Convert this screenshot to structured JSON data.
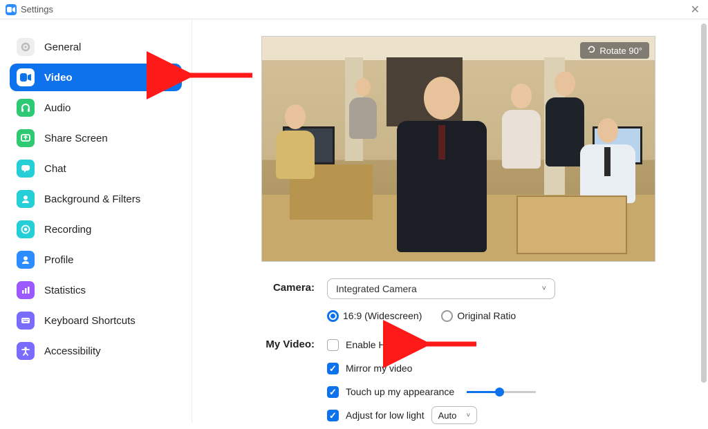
{
  "window": {
    "title": "Settings"
  },
  "sidebar": {
    "items": [
      {
        "label": "General"
      },
      {
        "label": "Video"
      },
      {
        "label": "Audio"
      },
      {
        "label": "Share Screen"
      },
      {
        "label": "Chat"
      },
      {
        "label": "Background & Filters"
      },
      {
        "label": "Recording"
      },
      {
        "label": "Profile"
      },
      {
        "label": "Statistics"
      },
      {
        "label": "Keyboard Shortcuts"
      },
      {
        "label": "Accessibility"
      }
    ]
  },
  "preview": {
    "rotate_label": "Rotate 90°"
  },
  "form": {
    "camera_label": "Camera:",
    "camera_select": "Integrated Camera",
    "ratio_wide": "16:9 (Widescreen)",
    "ratio_orig": "Original Ratio",
    "myvideo_label": "My Video:",
    "enable_hd": "Enable HD",
    "mirror": "Mirror my video",
    "touchup": "Touch up my appearance",
    "lowlight": "Adjust for low light",
    "lowlight_select": "Auto"
  }
}
